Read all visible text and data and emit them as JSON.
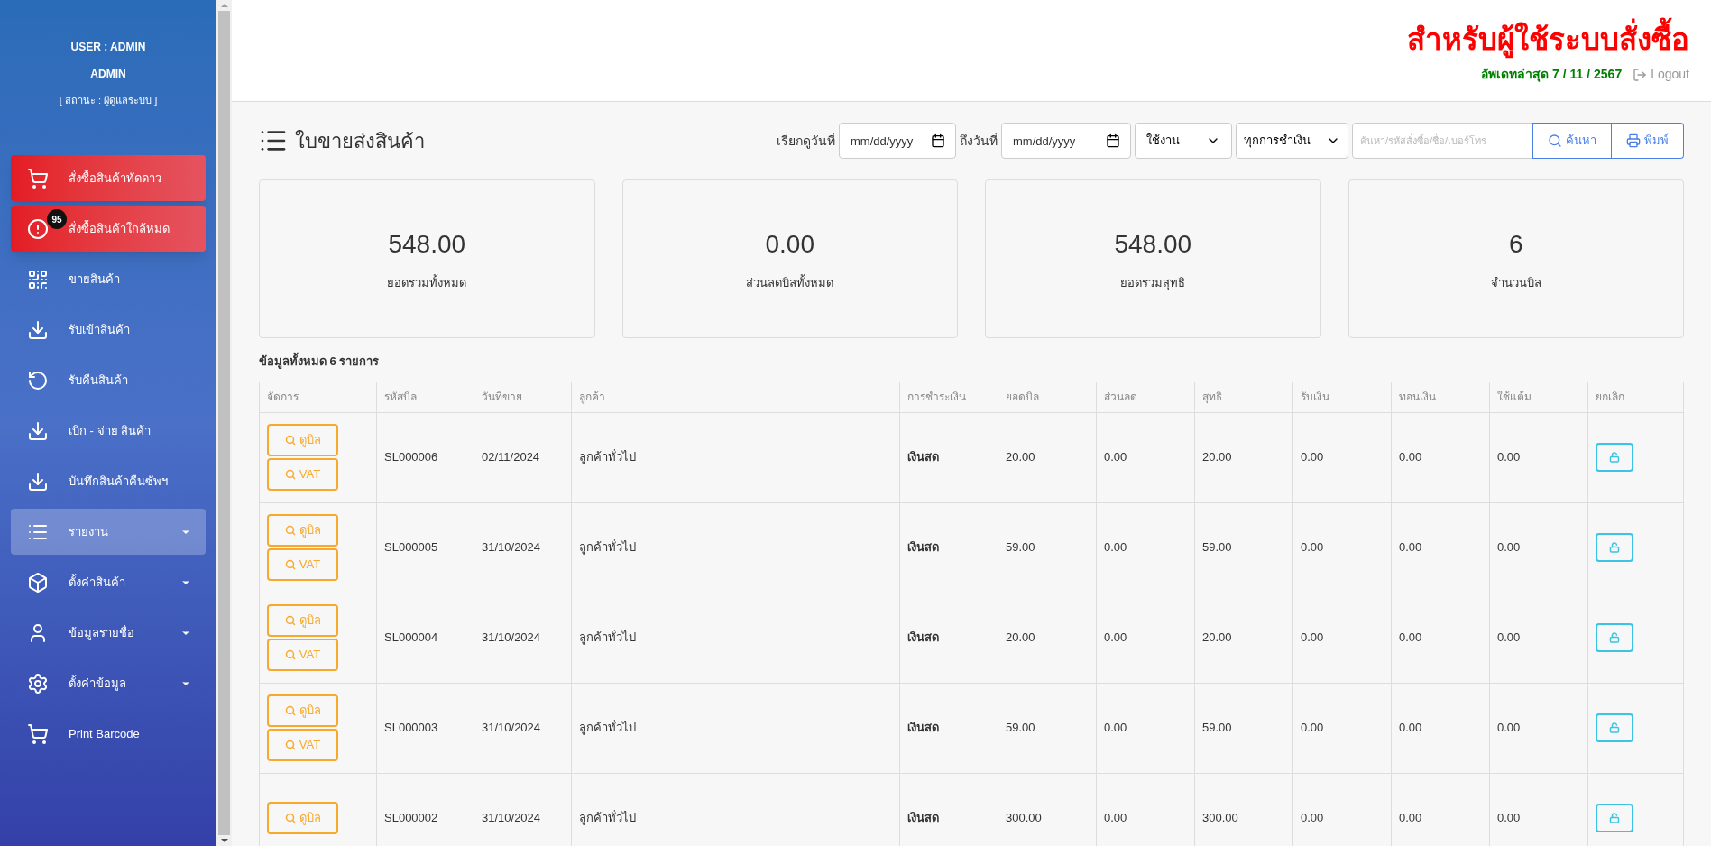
{
  "sidebar": {
    "user_line": "USER : ADMIN",
    "name": "ADMIN",
    "status": "[ สถานะ : ผู้ดูแลระบบ ]",
    "items": [
      {
        "label": "สั่งซื้อสินค้าทัดดาว",
        "kind": "highlight",
        "selected": false,
        "expandable": false
      },
      {
        "label": "สั่งซื้อสินค้าใกล้หมด",
        "kind": "highlight",
        "badge": "95",
        "selected": false,
        "expandable": false
      },
      {
        "label": "ขายสินค้า",
        "kind": "link",
        "selected": false,
        "expandable": false
      },
      {
        "label": "รับเข้าสินค้า",
        "kind": "link",
        "selected": false,
        "expandable": false
      },
      {
        "label": "รับคืนสินค้า",
        "kind": "link",
        "selected": false,
        "expandable": false
      },
      {
        "label": "เบิก - จ่าย สินค้า",
        "kind": "link",
        "selected": false,
        "expandable": false
      },
      {
        "label": "บันทึกสินค้าคืนซัพฯ",
        "kind": "link",
        "selected": false,
        "expandable": false
      },
      {
        "label": "รายงาน",
        "kind": "link",
        "selected": true,
        "expandable": true
      },
      {
        "label": "ตั้งค่าสินค้า",
        "kind": "link",
        "selected": false,
        "expandable": true
      },
      {
        "label": "ข้อมูลรายชื่อ",
        "kind": "link",
        "selected": false,
        "expandable": true
      },
      {
        "label": "ตั้งค่าข้อมูล",
        "kind": "link",
        "selected": false,
        "expandable": true
      },
      {
        "label": "Print Barcode",
        "kind": "link",
        "selected": false,
        "expandable": false
      }
    ]
  },
  "header": {
    "title": "สำหรับผู้ใช้ระบบสั่งซื้อ",
    "updated": "อัพเดทล่าสุด 7 / 11 / 2567",
    "logout": "Logout"
  },
  "page": {
    "title": "ใบขายส่งสินค้า",
    "filters": {
      "from_label": "เรียกดูวันที่",
      "from_placeholder": "mm/dd/yyyy",
      "to_label": "ถึงวันที่",
      "to_placeholder": "mm/dd/yyyy",
      "status": "ใช้งาน",
      "payment": "ทุกการชำเงิน",
      "search_placeholder": "ค้นหา/รหัสสั่งซื้อ/ชื่อ/เบอร์โทร",
      "search_button": "ค้นหา",
      "print_button": "พิมพ์"
    },
    "stats": [
      {
        "value": "548.00",
        "label": "ยอดรวมทั้งหมด"
      },
      {
        "value": "0.00",
        "label": "ส่วนลดบิลทั้งหมด"
      },
      {
        "value": "548.00",
        "label": "ยอดรวมสุทธิ"
      },
      {
        "value": "6",
        "label": "จำนวนบิล"
      }
    ],
    "summary": "ข้อมูลทั้งหมด 6 รายการ",
    "table": {
      "actions_header": "จัดการ",
      "columns": [
        "รหัสบิล",
        "วันที่ขาย",
        "ลูกค้า",
        "การชำระเงิน",
        "ยอดบิล",
        "ส่วนลด",
        "สุทธิ",
        "รับเงิน",
        "ทอนเงิน",
        "ใช้แต้ม"
      ],
      "cancel_header": "ยกเลิก",
      "rows": [
        {
          "view_button": "ดูบิล",
          "vat_button": "VAT",
          "cells": [
            "SL000006",
            "02/11/2024",
            "ลูกค้าทั่วไป",
            "เงินสด",
            "20.00",
            "0.00",
            "20.00",
            "0.00",
            "0.00",
            "0.00"
          ]
        },
        {
          "view_button": "ดูบิล",
          "vat_button": "VAT",
          "cells": [
            "SL000005",
            "31/10/2024",
            "ลูกค้าทั่วไป",
            "เงินสด",
            "59.00",
            "0.00",
            "59.00",
            "0.00",
            "0.00",
            "0.00"
          ]
        },
        {
          "view_button": "ดูบิล",
          "vat_button": "VAT",
          "cells": [
            "SL000004",
            "31/10/2024",
            "ลูกค้าทั่วไป",
            "เงินสด",
            "20.00",
            "0.00",
            "20.00",
            "0.00",
            "0.00",
            "0.00"
          ]
        },
        {
          "view_button": "ดูบิล",
          "vat_button": "VAT",
          "cells": [
            "SL000003",
            "31/10/2024",
            "ลูกค้าทั่วไป",
            "เงินสด",
            "59.00",
            "0.00",
            "59.00",
            "0.00",
            "0.00",
            "0.00"
          ]
        },
        {
          "view_button": "ดูบิล",
          "cells": [
            "SL000002",
            "31/10/2024",
            "ลูกค้าทั่วไป",
            "เงินสด",
            "300.00",
            "0.00",
            "300.00",
            "0.00",
            "0.00",
            "0.00"
          ]
        }
      ]
    }
  }
}
